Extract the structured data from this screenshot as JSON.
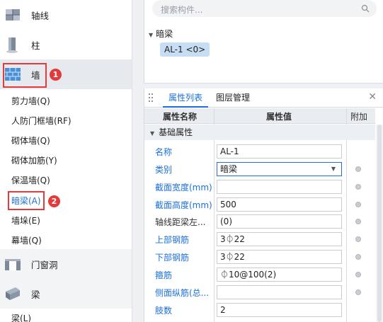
{
  "left": {
    "categories": [
      {
        "label": "轴线",
        "icon": "axis-icon"
      },
      {
        "label": "柱",
        "icon": "column-icon"
      },
      {
        "label": "墙",
        "icon": "wall-icon"
      },
      {
        "label": "门窗洞",
        "icon": "door-window-icon"
      },
      {
        "label": "梁",
        "icon": "beam-icon"
      }
    ],
    "wall_items": [
      "剪力墙(Q)",
      "人防门框墙(RF)",
      "砌体墙(Q)",
      "砌体加筋(Y)",
      "保温墙(Q)",
      "暗梁(A)",
      "墙垛(E)",
      "幕墙(Q)"
    ],
    "beam_items": [
      "梁(L)"
    ],
    "badges": [
      "1",
      "2"
    ]
  },
  "tree": {
    "search_placeholder": "搜索构件...",
    "root_label": "暗梁",
    "item_label": "AL-1 <0>"
  },
  "properties": {
    "tabs": [
      "属性列表",
      "图层管理"
    ],
    "headers": {
      "name": "属性名称",
      "value": "属性值",
      "extra": "附加"
    },
    "group": "基础属性",
    "rows": [
      {
        "name": "名称",
        "value": "AL-1",
        "blue": true,
        "dot": false
      },
      {
        "name": "类别",
        "value": "暗梁",
        "blue": true,
        "dot": true,
        "dropdown": true
      },
      {
        "name": "截面宽度(mm)",
        "value": "",
        "blue": true,
        "dot": true
      },
      {
        "name": "截面高度(mm)",
        "value": "500",
        "blue": true,
        "dot": true
      },
      {
        "name": "轴线距梁左...",
        "value": "(0)",
        "blue": false,
        "dot": true
      },
      {
        "name": "上部钢筋",
        "value": "3⏀22",
        "blue": true,
        "dot": true
      },
      {
        "name": "下部钢筋",
        "value": "3⏀22",
        "blue": true,
        "dot": true
      },
      {
        "name": "箍筋",
        "value": "⏀10@100(2)",
        "blue": true,
        "dot": true
      },
      {
        "name": "侧面纵筋(总...",
        "value": "",
        "blue": true,
        "dot": true
      },
      {
        "name": "肢数",
        "value": "2",
        "blue": true,
        "dot": false
      }
    ]
  },
  "colors": {
    "accent": "#1d6fd9",
    "highlight_red": "#e23b3b",
    "selected_bg": "#e6e9ee"
  }
}
